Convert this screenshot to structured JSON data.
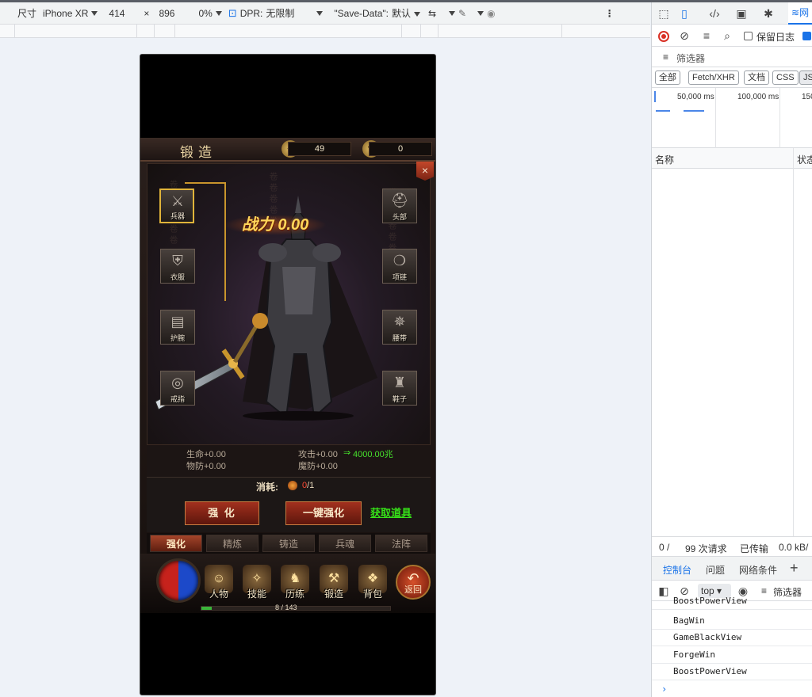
{
  "emulation_toolbar": {
    "dimensions_label": "尺寸",
    "device": "iPhone XR",
    "width": "414",
    "times": "×",
    "height": "896",
    "zoom": "0%",
    "dpr_label": "DPR:",
    "dpr_value": "无限制",
    "save_data_label": "\"Save-Data\":",
    "save_data_value": "默认"
  },
  "game": {
    "title": "锻造",
    "resource_1_value": "49",
    "resource_2_value": "0",
    "close": "×",
    "power_label": "战力",
    "power_value": "0.00",
    "slots": {
      "weapon": "兵器",
      "helmet": "头部",
      "armor": "衣服",
      "necklace": "项链",
      "bracer": "护腕",
      "belt": "腰带",
      "ring": "戒指",
      "boots": "鞋子"
    },
    "stats": {
      "hp": "生命+0.00",
      "attack": "攻击+0.00",
      "attack_arrow": "⇒",
      "attack_next": "4000.00兆",
      "pdef": "物防+0.00",
      "mdef": "魔防+0.00"
    },
    "cost_label": "消耗:",
    "cost_have": "0",
    "cost_need": "/1",
    "enhance_button": "强 化",
    "one_click_button": "一键强化",
    "get_item_link": "获取道具",
    "tabs": [
      "强化",
      "精炼",
      "铸造",
      "兵魂",
      "法阵"
    ],
    "nav": {
      "character": "人物",
      "skills": "技能",
      "training": "历练",
      "forge": "锻造",
      "bag": "背包",
      "return": "返回"
    },
    "exp_progress": 0.056,
    "exp_text": "8 / 143"
  },
  "devtools": {
    "network_tab": "网",
    "preserve_log": "保留日志",
    "filter_label": "筛选器",
    "types": [
      "全部",
      "Fetch/XHR",
      "文档",
      "CSS",
      "JS"
    ],
    "timeline": [
      "50,000 ms",
      "100,000 ms",
      "150"
    ],
    "col_name": "名称",
    "col_status": "状态",
    "summary": {
      "selected": "0 /",
      "requests": "99 次请求",
      "transferred": "已传输",
      "size": "0.0 kB/"
    },
    "drawer_tabs": [
      "控制台",
      "问题",
      "网络条件"
    ],
    "context": "top",
    "console_filter": "筛选器",
    "console_lines": [
      "BoostPowerView",
      "BagWin",
      "GameBlackView",
      "ForgeWin",
      "BoostPowerView"
    ]
  }
}
